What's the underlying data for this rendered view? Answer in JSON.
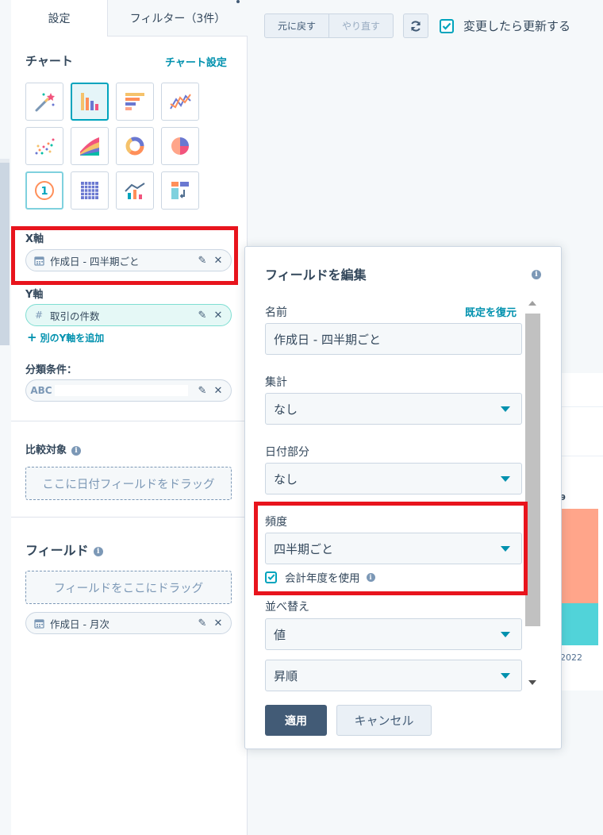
{
  "tabs": [
    {
      "label": "設定"
    },
    {
      "label": "フィルター（3件）"
    }
  ],
  "chart_section": {
    "title": "チャート",
    "settings_link": "チャート設定",
    "types": [
      {
        "icon": "magic-wand-icon",
        "selected": false
      },
      {
        "icon": "vertical-bar-chart-icon",
        "selected": true
      },
      {
        "icon": "horizontal-bar-chart-icon",
        "selected": false
      },
      {
        "icon": "line-chart-icon",
        "selected": false
      },
      {
        "icon": "scatter-chart-icon",
        "selected": false
      },
      {
        "icon": "area-chart-icon",
        "selected": false
      },
      {
        "icon": "donut-chart-icon",
        "selected": false
      },
      {
        "icon": "pie-chart-icon",
        "selected": false
      },
      {
        "icon": "single-value-icon",
        "selected": false,
        "glyph": "1"
      },
      {
        "icon": "pivot-table-icon",
        "selected": false
      },
      {
        "icon": "combo-chart-icon",
        "selected": false
      },
      {
        "icon": "table-icon",
        "selected": false
      }
    ]
  },
  "x_axis": {
    "label": "X軸",
    "field": "作成日 - 四半期ごと"
  },
  "y_axis": {
    "label": "Y軸",
    "field": "取引の件数",
    "add_label": "別のY軸を追加"
  },
  "breakdown": {
    "label": "分類条件：",
    "type_badge": "ABC"
  },
  "compare": {
    "label": "比較対象",
    "dropzone": "ここに日付フィールドをドラッグ"
  },
  "fields": {
    "label": "フィールド",
    "dropzone": "フィールドをここにドラッグ",
    "items": [
      {
        "label": "作成日 - 月次"
      }
    ]
  },
  "toolbar": {
    "undo": "元に戻す",
    "redo": "やり直す",
    "auto_update": "変更したら更新する"
  },
  "background_chart": {
    "value_label": "9",
    "year_label": "2022",
    "colors": [
      "#ffa58a",
      "#51d3d9"
    ]
  },
  "edit_field": {
    "title": "フィールドを編集",
    "name_label": "名前",
    "restore_default": "既定を復元",
    "name_value": "作成日 - 四半期ごと",
    "aggregation_label": "集計",
    "aggregation_value": "なし",
    "date_part_label": "日付部分",
    "date_part_value": "なし",
    "frequency_label": "頻度",
    "frequency_value": "四半期ごと",
    "fiscal_year_label": "会計年度を使用",
    "sort_label": "並べ替え",
    "sort_by_value": "値",
    "sort_order_value": "昇順",
    "apply": "適用",
    "cancel": "キャンセル"
  },
  "colors": {
    "accent": "#00a4bd",
    "link": "#0091ae",
    "highlight": "#e8141d",
    "primary_button": "#425b76"
  }
}
